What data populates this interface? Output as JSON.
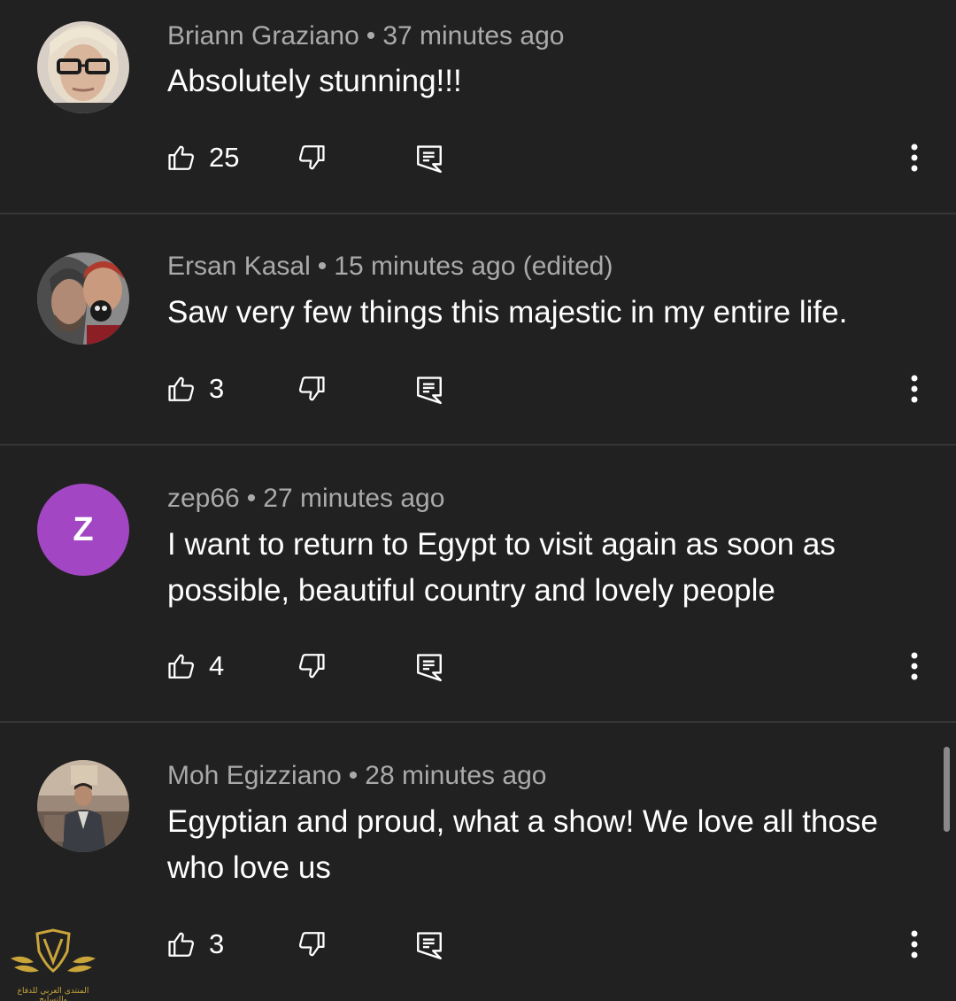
{
  "comments": [
    {
      "author": "Briann Graziano",
      "time": "37 minutes ago",
      "text": "Absolutely stunning!!!",
      "likes": "25",
      "avatar": "photo"
    },
    {
      "author": "Ersan Kasal",
      "time": "15 minutes ago (edited)",
      "text": "Saw very few things this majestic in my entire life.",
      "likes": "3",
      "avatar": "photo"
    },
    {
      "author": "zep66",
      "time": "27 minutes ago",
      "text": "I want to return to Egypt to visit again as soon as possible, beautiful country and lovely people",
      "likes": "4",
      "avatar_letter": "Z",
      "avatar_color": "#a346c3"
    },
    {
      "author": "Moh Egizziano",
      "time": "28 minutes ago",
      "text": "Egyptian and proud, what a show! We love all those who love us",
      "likes": "3",
      "avatar": "photo"
    }
  ],
  "separator": "•",
  "icons": {
    "like": "thumbs-up-outline-icon",
    "dislike": "thumbs-down-outline-icon",
    "reply": "reply-comment-icon",
    "more": "more-vertical-icon"
  },
  "watermark": {
    "text": "المنتدى العربي للدفاع والتسليح"
  },
  "colors": {
    "background": "#212121",
    "text_primary": "#ffffff",
    "text_secondary": "#aaaaaa",
    "divider": "#363636"
  }
}
